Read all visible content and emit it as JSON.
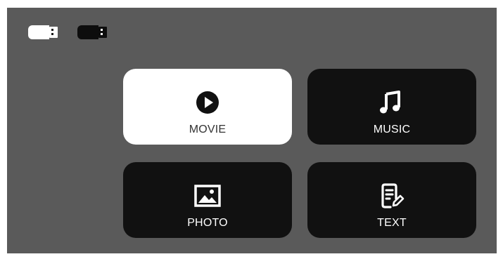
{
  "status": {
    "storage_icons": [
      "usb-drive-selected-icon",
      "usb-drive-icon"
    ]
  },
  "menu": {
    "selected": "MOVIE",
    "tiles": [
      {
        "label": "MOVIE",
        "icon": "play-circle-icon"
      },
      {
        "label": "MUSIC",
        "icon": "music-note-icon"
      },
      {
        "label": "PHOTO",
        "icon": "image-icon"
      },
      {
        "label": "TEXT",
        "icon": "document-edit-icon"
      }
    ]
  },
  "colors": {
    "background": "#5a5a5a",
    "tile": "#111111",
    "tile_selected": "#ffffff"
  }
}
